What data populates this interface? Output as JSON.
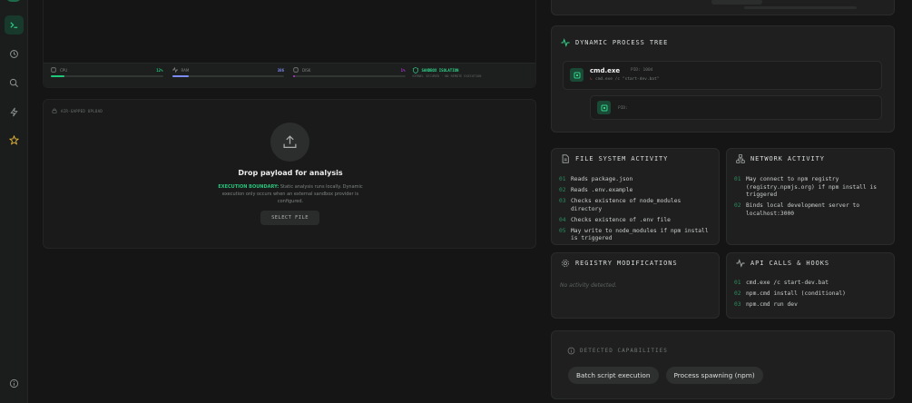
{
  "sidebar": {
    "items": [
      {
        "icon": "terminal-icon",
        "active": true
      },
      {
        "icon": "history-icon",
        "active": false
      },
      {
        "icon": "search-icon",
        "active": false
      },
      {
        "icon": "lightning-icon",
        "active": false
      },
      {
        "icon": "star-icon",
        "active": false
      }
    ],
    "bottom_icon": "info-icon"
  },
  "metrics": [
    {
      "label": "CPU",
      "value": "12%",
      "fill": 0.12,
      "color": "#1fc77b"
    },
    {
      "label": "RAM",
      "value": "386",
      "fill": 0.15,
      "color": "#7b8cf5"
    },
    {
      "label": "DISK",
      "value": "1%",
      "fill": 0.02,
      "color": "#b535d8"
    }
  ],
  "security": {
    "title": "SANDBOX ISOLATION",
    "subtitle": "KERNEL SECURED · NO REMOTE EXECUTION"
  },
  "upload": {
    "header": "AIR-GAPPED UPLOAD",
    "title": "Drop payload for analysis",
    "emphasis": "EXECUTION BOUNDARY:",
    "description": " Static analysis runs locally. Dynamic execution only occurs when an external sandbox provider is configured.",
    "button": "SELECT FILE"
  },
  "process_tree": {
    "title": "DYNAMIC PROCESS TREE",
    "root": {
      "name": "cmd.exe",
      "pid": "PID: 1004",
      "command": "cmd.exe /c \"start-dev.bat\""
    },
    "child": {
      "pid": "PID:"
    }
  },
  "file_system": {
    "title": "FILE SYSTEM ACTIVITY",
    "items": [
      {
        "idx": "01",
        "text": "Reads package.json"
      },
      {
        "idx": "02",
        "text": "Reads .env.example"
      },
      {
        "idx": "03",
        "text": "Checks existence of node_modules directory"
      },
      {
        "idx": "04",
        "text": "Checks existence of .env file"
      },
      {
        "idx": "05",
        "text": "May write to node_modules if npm install is triggered"
      }
    ]
  },
  "network": {
    "title": "NETWORK ACTIVITY",
    "items": [
      {
        "idx": "01",
        "text": "May connect to npm registry (registry.npmjs.org) if npm install is triggered"
      },
      {
        "idx": "02",
        "text": "Binds local development server to localhost:3000"
      }
    ]
  },
  "registry": {
    "title": "REGISTRY MODIFICATIONS",
    "empty": "No activity detected."
  },
  "api_calls": {
    "title": "API CALLS & HOOKS",
    "items": [
      {
        "idx": "01",
        "text": "cmd.exe /c start-dev.bat"
      },
      {
        "idx": "02",
        "text": "npm.cmd install (conditional)"
      },
      {
        "idx": "03",
        "text": "npm.cmd run dev"
      }
    ]
  },
  "capabilities": {
    "title": "DETECTED CAPABILITIES",
    "pills": [
      "Batch script execution",
      "Process spawning (npm)"
    ]
  },
  "colors": {
    "accent": "#27c47c",
    "background": "#151515",
    "panel": "#1f1f1f"
  }
}
